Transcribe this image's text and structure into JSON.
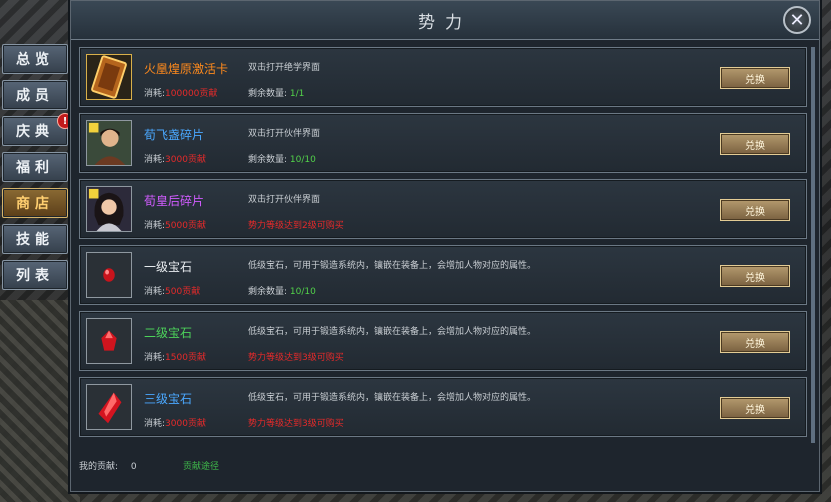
{
  "panel": {
    "title": "势力",
    "close_glyph": "✕"
  },
  "tabs": [
    {
      "label": "总览",
      "active": false,
      "badge": ""
    },
    {
      "label": "成员",
      "active": false,
      "badge": ""
    },
    {
      "label": "庆典",
      "active": false,
      "badge": "!"
    },
    {
      "label": "福利",
      "active": false,
      "badge": ""
    },
    {
      "label": "商店",
      "active": true,
      "badge": ""
    },
    {
      "label": "技能",
      "active": false,
      "badge": ""
    },
    {
      "label": "列表",
      "active": false,
      "badge": ""
    }
  ],
  "items": [
    {
      "name": "火凰煌原激活卡",
      "name_color": "#ff8a1c",
      "icon": "card-icon",
      "cost_label": "消耗:",
      "cost": "100000贡献",
      "desc": "双击打开绝学界面",
      "remain_label": "剩余数量:",
      "remain": "1/1",
      "remain_warn": false,
      "button": "兑换"
    },
    {
      "name": "荀飞盏碎片",
      "name_color": "#4aa8ff",
      "icon": "portrait-male-icon",
      "cost_label": "消耗:",
      "cost": "3000贡献",
      "desc": "双击打开伙伴界面",
      "remain_label": "剩余数量:",
      "remain": "10/10",
      "remain_warn": false,
      "button": "兑换"
    },
    {
      "name": "荀皇后碎片",
      "name_color": "#d15cff",
      "icon": "portrait-female-icon",
      "cost_label": "消耗:",
      "cost": "5000贡献",
      "desc": "双击打开伙伴界面",
      "remain_label": "",
      "remain": "势力等级达到2级可购买",
      "remain_warn": true,
      "button": "兑换"
    },
    {
      "name": "一级宝石",
      "name_color": "#e8ecef",
      "icon": "gem-small-icon",
      "cost_label": "消耗:",
      "cost": "500贡献",
      "desc": "低级宝石，可用于锻造系统内，镶嵌在装备上，会增加人物对应的属性。",
      "remain_label": "剩余数量:",
      "remain": "10/10",
      "remain_warn": false,
      "button": "兑换"
    },
    {
      "name": "二级宝石",
      "name_color": "#4cd25a",
      "icon": "gem-medium-icon",
      "cost_label": "消耗:",
      "cost": "1500贡献",
      "desc": "低级宝石，可用于锻造系统内，镶嵌在装备上，会增加人物对应的属性。",
      "remain_label": "",
      "remain": "势力等级达到3级可购买",
      "remain_warn": true,
      "button": "兑换"
    },
    {
      "name": "三级宝石",
      "name_color": "#4aa8ff",
      "icon": "gem-large-icon",
      "cost_label": "消耗:",
      "cost": "3000贡献",
      "desc": "低级宝石，可用于锻造系统内，镶嵌在装备上，会增加人物对应的属性。",
      "remain_label": "",
      "remain": "势力等级达到3级可购买",
      "remain_warn": true,
      "button": "兑换"
    }
  ],
  "footer": {
    "label": "我的贡献:",
    "value": "0",
    "link": "贡献途径"
  }
}
